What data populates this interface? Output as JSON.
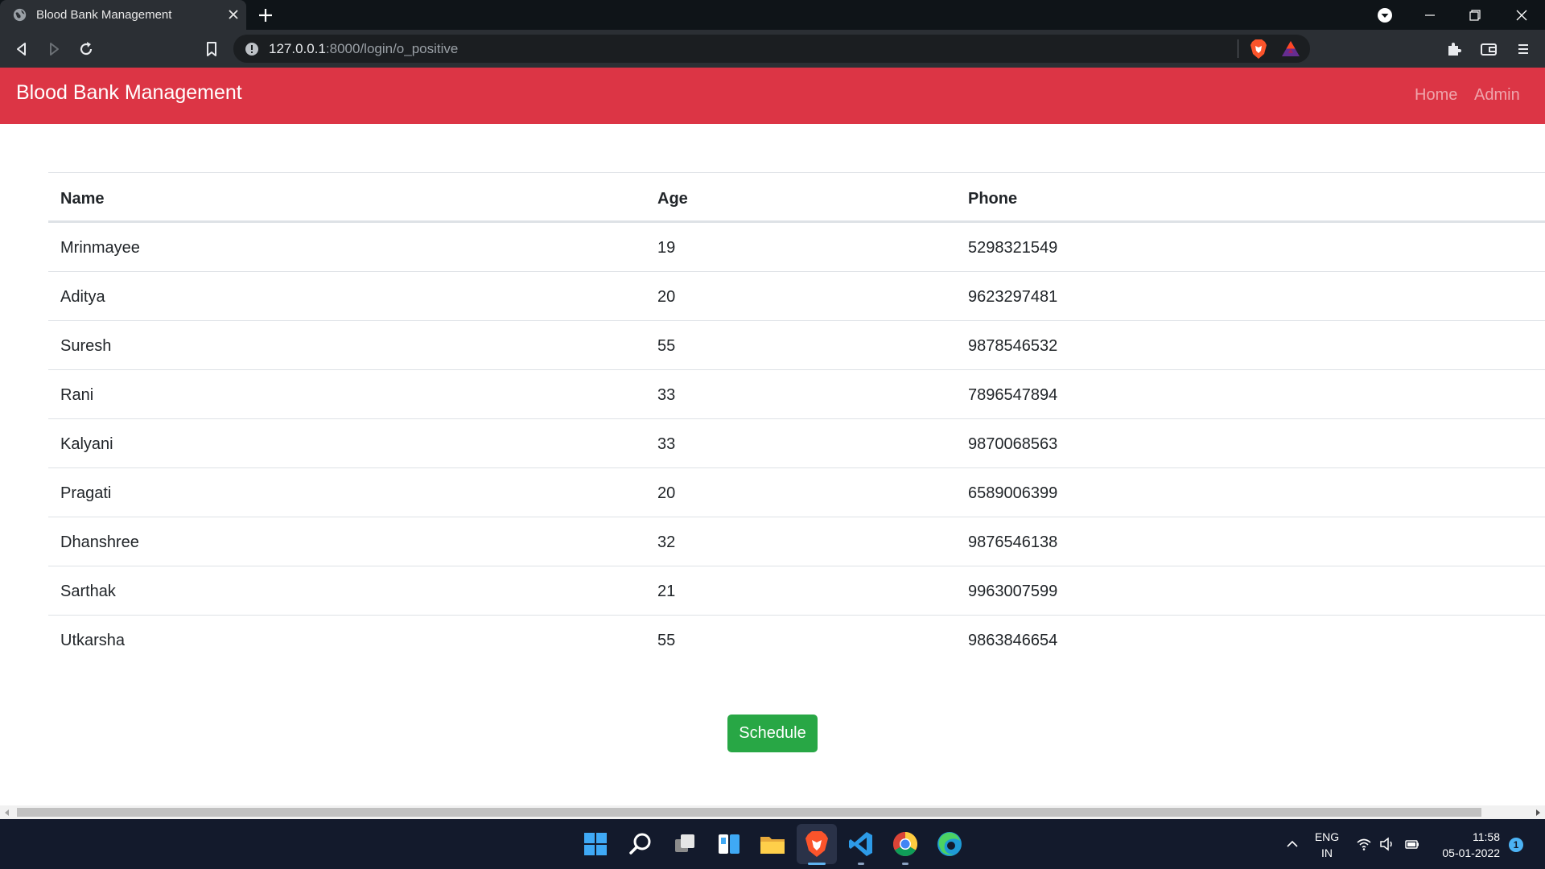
{
  "browser": {
    "tab_title": "Blood Bank Management",
    "url_host": "127.0.0.1",
    "url_rest": ":8000/login/o_positive"
  },
  "navbar": {
    "brand": "Blood Bank Management",
    "links": [
      "Home",
      "Admin"
    ],
    "color": "#dc3545"
  },
  "table": {
    "headers": [
      "Name",
      "Age",
      "Phone"
    ],
    "rows": [
      [
        "Mrinmayee",
        "19",
        "5298321549"
      ],
      [
        "Aditya",
        "20",
        "9623297481"
      ],
      [
        "Suresh",
        "55",
        "9878546532"
      ],
      [
        "Rani",
        "33",
        "7896547894"
      ],
      [
        "Kalyani",
        "33",
        "9870068563"
      ],
      [
        "Pragati",
        "20",
        "6589006399"
      ],
      [
        "Dhanshree",
        "32",
        "9876546138"
      ],
      [
        "Sarthak",
        "21",
        "9963007599"
      ],
      [
        "Utkarsha",
        "55",
        "9863846654"
      ]
    ]
  },
  "schedule_button": "Schedule",
  "taskbar": {
    "lang_top": "ENG",
    "lang_bottom": "IN",
    "time": "11:58",
    "date": "05-01-2022",
    "notification_count": "1"
  }
}
